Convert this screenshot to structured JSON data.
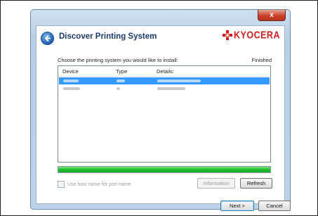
{
  "window": {
    "title": "Discover Printing System",
    "close_label": "x",
    "brand": "KYOCERA"
  },
  "prompt": "Choose the printing system you would like to install:",
  "status": "Finished",
  "table": {
    "headers": [
      "Device",
      "Type",
      "Details:"
    ],
    "rows": [
      {
        "selected": true
      },
      {
        "selected": false
      }
    ]
  },
  "progress": {
    "fraction": 1.0
  },
  "options": {
    "use_host_name_label": "Use host name for port name",
    "use_host_name_checked": false
  },
  "buttons": {
    "information": "Information",
    "refresh": "Refresh",
    "next": "Next >",
    "cancel": "Cancel"
  },
  "colors": {
    "brand": "#d11c1c",
    "selection": "#3399ff",
    "progress": "#1fbf2a"
  }
}
